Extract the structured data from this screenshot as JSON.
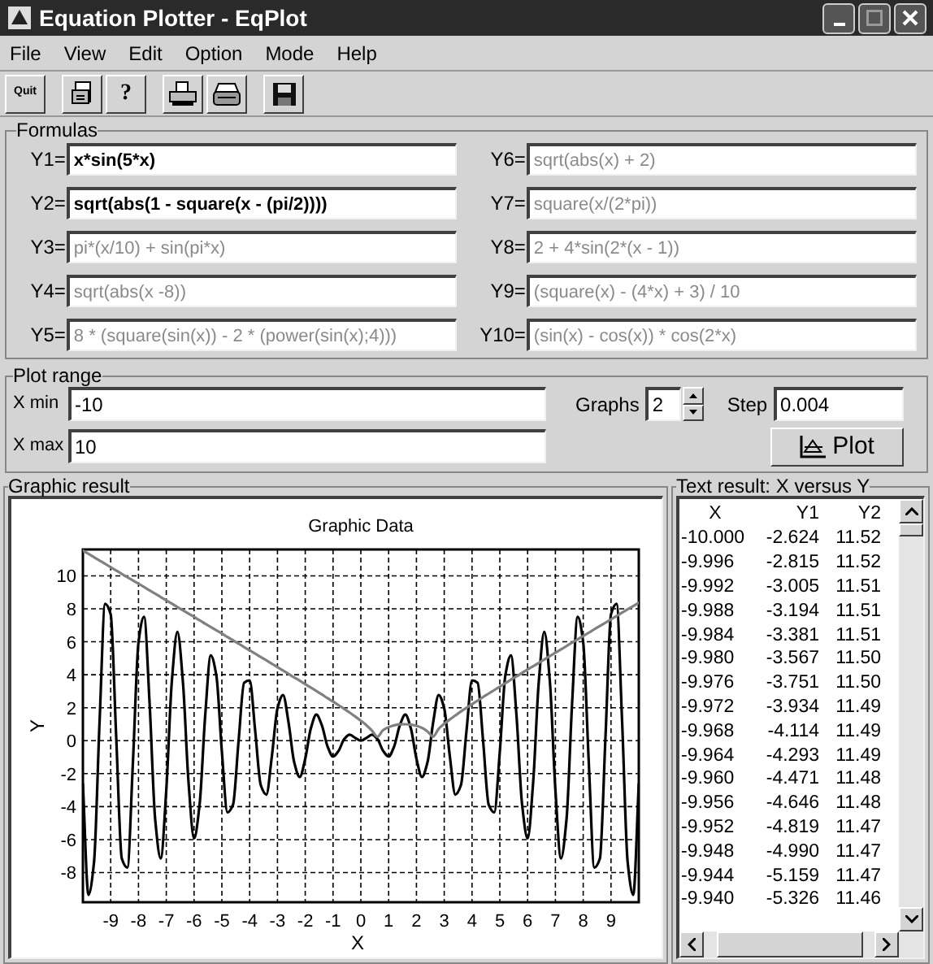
{
  "window": {
    "title": "Equation Plotter - EqPlot"
  },
  "menu": [
    "File",
    "View",
    "Edit",
    "Option",
    "Mode",
    "Help"
  ],
  "toolbar": {
    "quit_label": "Quit",
    "help_label": "?"
  },
  "formulas": {
    "title": "Formulas",
    "items": [
      {
        "label": "Y1=",
        "value": "x*sin(5*x)",
        "disabled": false
      },
      {
        "label": "Y2=",
        "value": "sqrt(abs(1 - square(x - (pi/2))))",
        "disabled": false
      },
      {
        "label": "Y3=",
        "value": "pi*(x/10) + sin(pi*x)",
        "disabled": true
      },
      {
        "label": "Y4=",
        "value": "sqrt(abs(x -8))",
        "disabled": true
      },
      {
        "label": "Y5=",
        "value": "8 * (square(sin(x)) - 2 * (power(sin(x);4)))",
        "disabled": true
      },
      {
        "label": "Y6=",
        "value": "sqrt(abs(x) + 2)",
        "disabled": true
      },
      {
        "label": "Y7=",
        "value": "square(x/(2*pi))",
        "disabled": true
      },
      {
        "label": "Y8=",
        "value": "2 + 4*sin(2*(x - 1))",
        "disabled": true
      },
      {
        "label": "Y9=",
        "value": "(square(x) - (4*x) + 3) / 10",
        "disabled": true
      },
      {
        "label": "Y10=",
        "value": "(sin(x) - cos(x)) * cos(2*x)",
        "disabled": true
      }
    ]
  },
  "plot_range": {
    "title": "Plot range",
    "xmin_label": "X min",
    "xmin": "-10",
    "xmax_label": "X max",
    "xmax": "10",
    "graphs_label": "Graphs",
    "graphs": "2",
    "step_label": "Step",
    "step": "0.004",
    "plot_button": "Plot"
  },
  "graphic_result": {
    "title": "Graphic result",
    "chart_data": {
      "type": "line",
      "title": "Graphic Data",
      "xlabel": "X",
      "ylabel": "Y",
      "grid": true,
      "xlim": [
        -10,
        10
      ],
      "ylim": [
        -9.8,
        11.6
      ],
      "xticks": [
        -9,
        -8,
        -7,
        -6,
        -5,
        -4,
        -3,
        -2,
        -1,
        0,
        1,
        2,
        3,
        4,
        5,
        6,
        7,
        8,
        9
      ],
      "yticks": [
        -8,
        -6,
        -4,
        -2,
        0,
        2,
        4,
        6,
        8,
        10
      ],
      "x": [
        -10,
        -9.8,
        -9.6,
        -9.4,
        -9.2,
        -9,
        -8.8,
        -8.6,
        -8.4,
        -8.2,
        -8,
        -7.8,
        -7.6,
        -7.4,
        -7.2,
        -7,
        -6.8,
        -6.6,
        -6.4,
        -6.2,
        -6,
        -5.8,
        -5.6,
        -5.4,
        -5.2,
        -5,
        -4.8,
        -4.6,
        -4.4,
        -4.2,
        -4,
        -3.8,
        -3.6,
        -3.4,
        -3.2,
        -3,
        -2.8,
        -2.6,
        -2.4,
        -2.2,
        -2,
        -1.8,
        -1.6,
        -1.4,
        -1.2,
        -1,
        -0.8,
        -0.6,
        -0.4,
        -0.2,
        0,
        0.2,
        0.4,
        0.6,
        0.8,
        1,
        1.2,
        1.4,
        1.6,
        1.8,
        2,
        2.2,
        2.4,
        2.6,
        2.8,
        3,
        3.2,
        3.4,
        3.6,
        3.8,
        4,
        4.2,
        4.4,
        4.6,
        4.8,
        5,
        5.2,
        5.4,
        5.6,
        5.8,
        6,
        6.2,
        6.4,
        6.6,
        6.8,
        7,
        7.2,
        7.4,
        7.6,
        7.8,
        8,
        8.2,
        8.4,
        8.6,
        8.8,
        9,
        9.2,
        9.4,
        9.6,
        9.8,
        10
      ],
      "series": [
        {
          "color": "#000000",
          "values": [
            -2.62,
            -9.35,
            -7.38,
            1.16,
            8.3,
            7.66,
            0.16,
            -7.15,
            -7.7,
            -1.3,
            5.96,
            7.52,
            2.25,
            -4.76,
            -7.14,
            -3.0,
            3.6,
            6.6,
            3.53,
            -2.51,
            -5.93,
            -3.85,
            1.52,
            5.17,
            3.97,
            -0.66,
            -4.35,
            -3.89,
            -0.04,
            3.51,
            3.65,
            0.57,
            -2.7,
            -3.27,
            -0.92,
            1.95,
            2.77,
            1.09,
            -1.29,
            -2.2,
            -1.09,
            0.74,
            1.58,
            0.92,
            -0.34,
            -0.96,
            -0.61,
            0.09,
            0.36,
            0.17,
            0,
            0.17,
            0.36,
            0.09,
            -0.61,
            -0.96,
            -0.34,
            0.92,
            1.58,
            0.74,
            -1.09,
            -2.2,
            -1.29,
            1.09,
            2.77,
            1.95,
            -0.92,
            -3.27,
            -2.7,
            0.57,
            3.65,
            3.51,
            -0.04,
            -3.89,
            -4.35,
            -0.66,
            3.97,
            5.17,
            1.52,
            -3.85,
            -5.93,
            -2.51,
            3.53,
            6.6,
            3.6,
            -3.0,
            -7.14,
            -4.76,
            2.25,
            7.52,
            5.96,
            -1.3,
            -7.7,
            -7.15,
            0.16,
            7.66,
            8.3,
            1.16,
            -7.38,
            -9.35,
            -2.62
          ]
        },
        {
          "color": "#808080",
          "values": [
            11.53,
            11.33,
            11.13,
            10.93,
            10.73,
            10.52,
            10.32,
            10.12,
            9.92,
            9.72,
            9.52,
            9.32,
            9.12,
            8.92,
            8.71,
            8.51,
            8.31,
            8.11,
            7.91,
            7.71,
            7.51,
            7.3,
            7.1,
            6.9,
            6.7,
            6.5,
            6.29,
            6.09,
            5.89,
            5.68,
            5.48,
            5.28,
            5.07,
            4.87,
            4.67,
            4.46,
            4.26,
            4.05,
            3.84,
            3.64,
            3.43,
            3.22,
            3.01,
            2.8,
            2.58,
            2.37,
            2.15,
            1.93,
            1.7,
            1.46,
            1.21,
            0.94,
            0.61,
            0.24,
            0.64,
            0.82,
            0.93,
            0.99,
            1.0,
            0.97,
            0.9,
            0.78,
            0.56,
            0.24,
            0.72,
            1.02,
            1.29,
            1.53,
            1.77,
            1.99,
            2.21,
            2.43,
            2.65,
            2.86,
            3.07,
            3.28,
            3.49,
            3.7,
            3.9,
            4.11,
            4.32,
            4.52,
            4.72,
            4.93,
            5.13,
            5.34,
            5.54,
            5.74,
            5.95,
            6.15,
            6.35,
            6.55,
            6.76,
            6.96,
            7.16,
            7.36,
            7.56,
            7.77,
            7.97,
            8.17,
            8.37
          ]
        }
      ]
    }
  },
  "text_result": {
    "title": "Text result: X versus Y",
    "columns": [
      "X",
      "Y1",
      "Y2"
    ],
    "rows": [
      [
        "-10.000",
        "-2.624",
        "11.52"
      ],
      [
        "-9.996",
        "-2.815",
        "11.52"
      ],
      [
        "-9.992",
        "-3.005",
        "11.51"
      ],
      [
        "-9.988",
        "-3.194",
        "11.51"
      ],
      [
        "-9.984",
        "-3.381",
        "11.51"
      ],
      [
        "-9.980",
        "-3.567",
        "11.50"
      ],
      [
        "-9.976",
        "-3.751",
        "11.50"
      ],
      [
        "-9.972",
        "-3.934",
        "11.49"
      ],
      [
        "-9.968",
        "-4.114",
        "11.49"
      ],
      [
        "-9.964",
        "-4.293",
        "11.49"
      ],
      [
        "-9.960",
        "-4.471",
        "11.48"
      ],
      [
        "-9.956",
        "-4.646",
        "11.48"
      ],
      [
        "-9.952",
        "-4.819",
        "11.47"
      ],
      [
        "-9.948",
        "-4.990",
        "11.47"
      ],
      [
        "-9.944",
        "-5.159",
        "11.47"
      ],
      [
        "-9.940",
        "-5.326",
        "11.46"
      ]
    ]
  }
}
